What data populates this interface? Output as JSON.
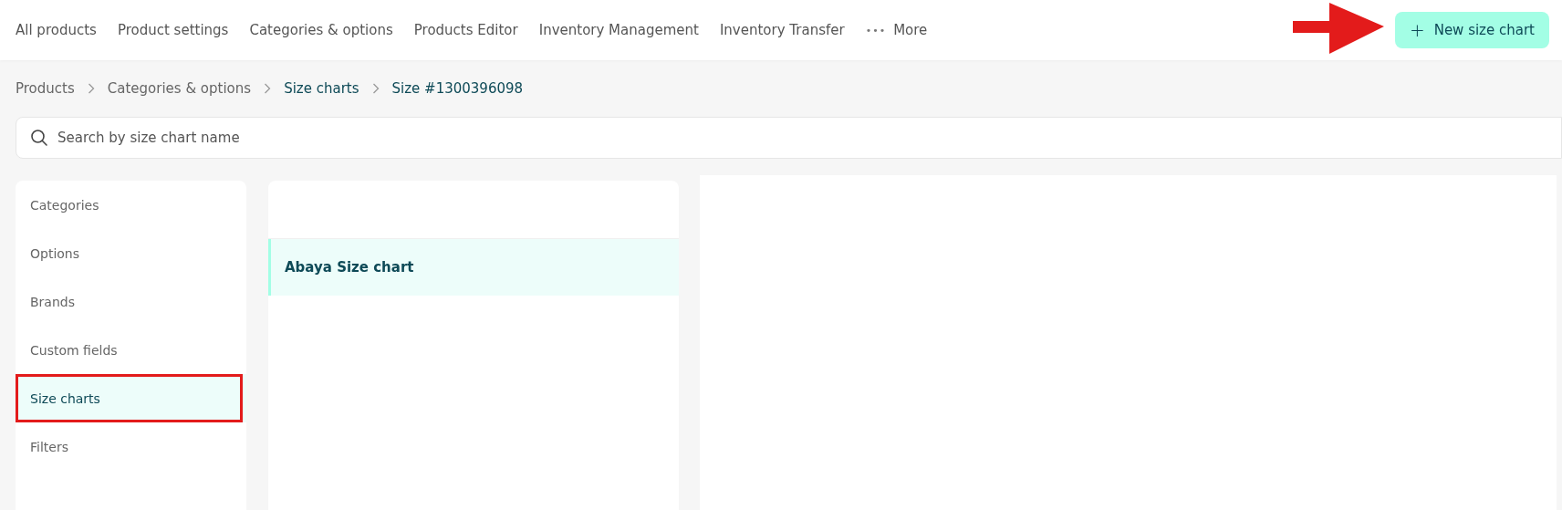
{
  "nav": {
    "items": [
      {
        "label": "All products"
      },
      {
        "label": "Product settings"
      },
      {
        "label": "Categories & options"
      },
      {
        "label": "Products Editor"
      },
      {
        "label": "Inventory Management"
      },
      {
        "label": "Inventory Transfer"
      }
    ],
    "more": {
      "icon": "•••",
      "label": "More"
    },
    "action": {
      "icon": "+",
      "label": "New size chart"
    }
  },
  "breadcrumb": [
    {
      "label": "Products",
      "current": false
    },
    {
      "label": "Categories & options",
      "current": false
    },
    {
      "label": "Size charts",
      "current": true
    },
    {
      "label": "Size #1300396098",
      "current": true
    }
  ],
  "search": {
    "placeholder": "Search by size chart name"
  },
  "sidebar": {
    "items": [
      {
        "label": "Categories",
        "selected": false
      },
      {
        "label": "Options",
        "selected": false
      },
      {
        "label": "Brands",
        "selected": false
      },
      {
        "label": "Custom fields",
        "selected": false
      },
      {
        "label": "Size charts",
        "selected": true
      },
      {
        "label": "Filters",
        "selected": false
      }
    ]
  },
  "size_charts": {
    "items": [
      {
        "label": "Abaya Size chart",
        "selected": true
      }
    ]
  }
}
